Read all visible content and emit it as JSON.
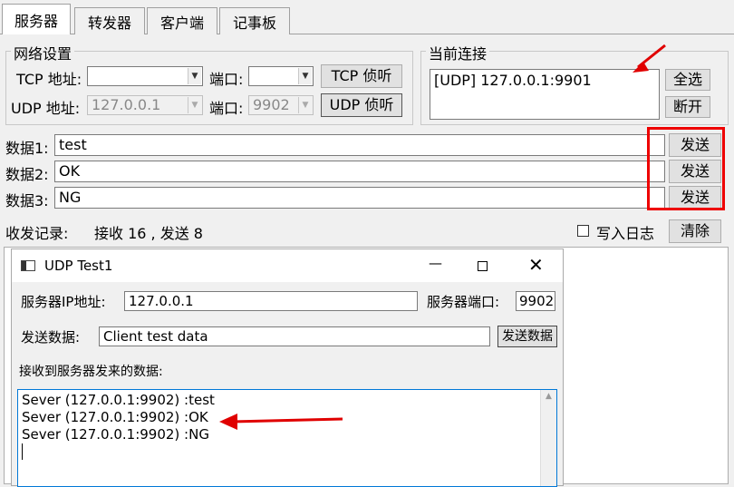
{
  "tabs": [
    "服务器",
    "转发器",
    "客户端",
    "记事板"
  ],
  "net_settings": {
    "title": "网络设置",
    "tcp_label": "TCP 地址:",
    "tcp_address": "",
    "tcp_port_label": "端口:",
    "tcp_port": "",
    "tcp_listen": "TCP 侦听",
    "udp_label": "UDP 地址:",
    "udp_address": "127.0.0.1",
    "udp_port_label": "端口:",
    "udp_port": "9902",
    "udp_listen": "UDP 侦听"
  },
  "connections": {
    "title": "当前连接",
    "items": [
      "[UDP] 127.0.0.1:9901"
    ],
    "select_all": "全选",
    "disconnect": "断开"
  },
  "data_rows": [
    {
      "label": "数据1:",
      "value": "test",
      "send": "发送"
    },
    {
      "label": "数据2:",
      "value": "OK",
      "send": "发送"
    },
    {
      "label": "数据3:",
      "value": "NG",
      "send": "发送"
    }
  ],
  "log": {
    "label": "收发记录:",
    "stats": "接收 16 , 发送 8",
    "write_log": "写入日志",
    "clear": "清除"
  },
  "client_window": {
    "title": "UDP Test1",
    "server_ip_label": "服务器IP地址:",
    "server_ip": "127.0.0.1",
    "server_port_label": "服务器端口:",
    "server_port": "9902",
    "send_data_label": "发送数据:",
    "send_data": "Client test data",
    "send_button": "发送数据",
    "received_label": "接收到服务器发来的数据:",
    "received_lines": [
      "Sever (127.0.0.1:9902) :test",
      "Sever (127.0.0.1:9902) :OK",
      "Sever (127.0.0.1:9902) :NG"
    ]
  },
  "colors": {
    "annotation": "#e00000",
    "accent_focus": "#0078d7"
  }
}
